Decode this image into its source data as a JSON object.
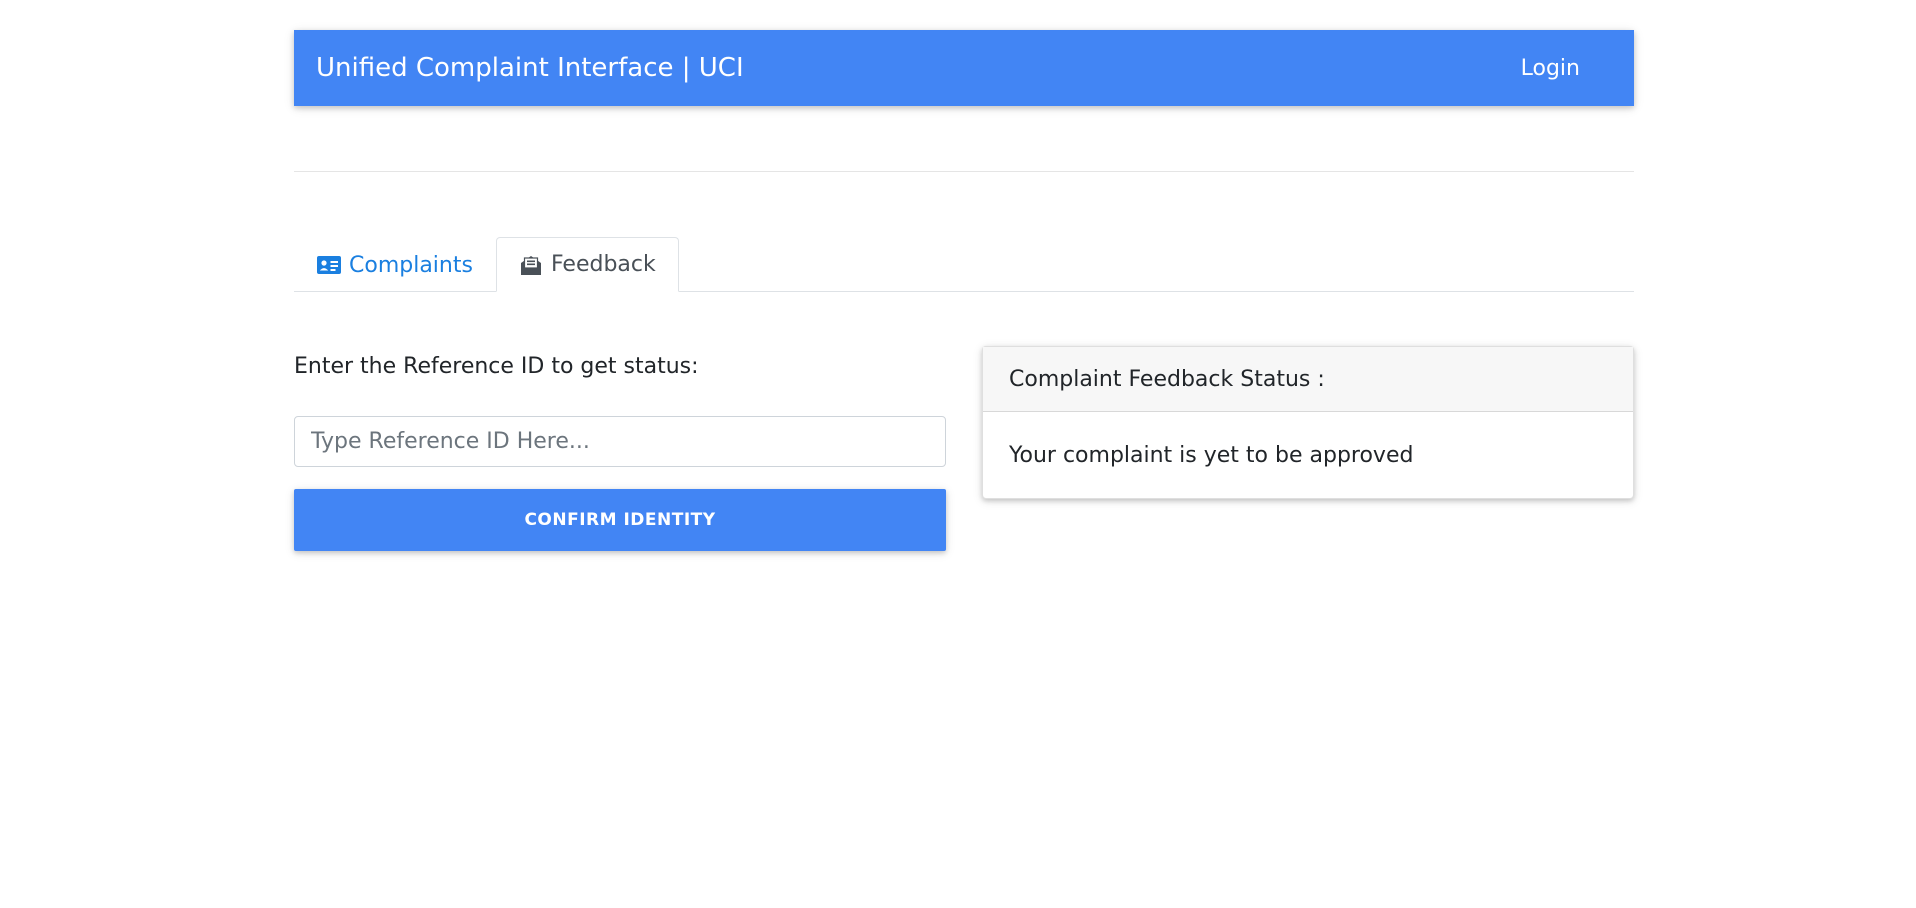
{
  "navbar": {
    "brand": "Unified Complaint Interface | UCI",
    "login_label": "Login"
  },
  "tabs": [
    {
      "label": "Complaints",
      "icon": "id-card-icon",
      "active": false
    },
    {
      "label": "Feedback",
      "icon": "envelope-open-text-icon",
      "active": true
    }
  ],
  "form": {
    "label": "Enter the Reference ID to get status:",
    "input_value": "",
    "input_placeholder": "Type Reference ID Here...",
    "button_label": "CONFIRM IDENTITY"
  },
  "status_card": {
    "header": "Complaint Feedback Status :",
    "body": "Your complaint is yet to be approved"
  },
  "colors": {
    "primary": "#4285f4",
    "link": "#1a7fe0"
  }
}
